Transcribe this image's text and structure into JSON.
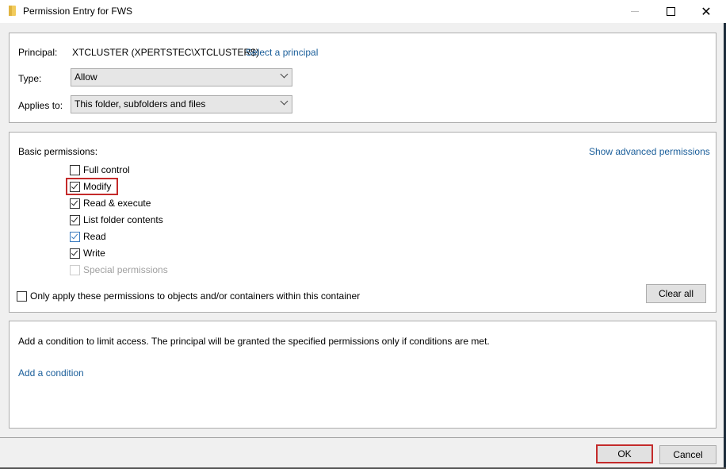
{
  "window": {
    "title": "Permission Entry for FWS",
    "icon": "folder-icon",
    "controls": [
      "minimize",
      "maximize",
      "close"
    ]
  },
  "principal_section": {
    "principal_label": "Principal:",
    "principal_value": "XTCLUSTER (XPERTSTEC\\XTCLUSTER$)",
    "select_principal_link": "Select a principal",
    "type_label": "Type:",
    "type_value": "Allow",
    "applies_to_label": "Applies to:",
    "applies_to_value": "This folder, subfolders and files"
  },
  "permissions_section": {
    "heading": "Basic permissions:",
    "show_advanced_link": "Show advanced permissions",
    "permissions": [
      {
        "label": "Full control",
        "checked": false,
        "enabled": true
      },
      {
        "label": "Modify",
        "checked": true,
        "enabled": true,
        "highlighted": true
      },
      {
        "label": "Read & execute",
        "checked": true,
        "enabled": true
      },
      {
        "label": "List folder contents",
        "checked": true,
        "enabled": true
      },
      {
        "label": "Read",
        "checked": true,
        "enabled": true
      },
      {
        "label": "Write",
        "checked": true,
        "enabled": true
      },
      {
        "label": "Special permissions",
        "checked": false,
        "enabled": false
      }
    ],
    "only_apply_label": "Only apply these permissions to objects and/or containers within this container",
    "only_apply_checked": false,
    "clear_all_label": "Clear all"
  },
  "condition_section": {
    "description": "Add a condition to limit access. The principal will be granted the specified permissions only if conditions are met.",
    "add_condition_link": "Add a condition"
  },
  "footer": {
    "ok_label": "OK",
    "cancel_label": "Cancel"
  },
  "colors": {
    "link": "#1a5e9a",
    "highlight": "#c42b2b"
  }
}
